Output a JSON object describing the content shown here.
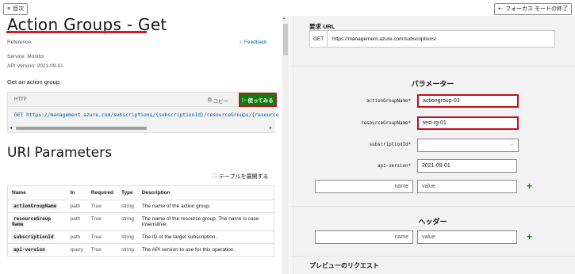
{
  "top": {
    "toc_label": "目次",
    "focus_exit_label": "フォーカス モードの終了"
  },
  "doc": {
    "title": "Action Groups - Get",
    "reference": "Reference",
    "feedback": "Feedback",
    "service": "Service:  Monitor",
    "api_version": "API Version:  2021-09-01",
    "description": "Get an action group.",
    "code": {
      "lang": "HTTP",
      "copy": "コピー",
      "try": "使ってみる",
      "line": "GET https://management.azure.com/subscriptions/{subscriptionId}/resourceGroups/{resource"
    },
    "uri_params_heading": "URI Parameters",
    "expand_table": "テーブルを展開する",
    "table": {
      "headers": [
        "Name",
        "In",
        "Required",
        "Type",
        "Description"
      ],
      "rows": [
        {
          "name": "actionGroupName",
          "in": "path",
          "required": "True",
          "type": "string",
          "desc": "The name of the action group."
        },
        {
          "name": "resourceGroup Name",
          "in": "path",
          "required": "True",
          "type": "string",
          "desc": "The name of the resource group. The name is case insensitive."
        },
        {
          "name": "subscriptionId",
          "in": "path",
          "required": "True",
          "type": "string",
          "desc": "The ID of the target subscription."
        },
        {
          "name": "api-version",
          "in": "query",
          "required": "True",
          "type": "string",
          "desc": "The API version to use for this operation."
        }
      ]
    }
  },
  "tryit": {
    "request_url_label": "要求 URL",
    "method": "GET",
    "url": "https://management.azure.com/subscriptions/",
    "params_title": "パラメーター",
    "params": {
      "action_group_label": "actionGroupName*",
      "action_group_value": "actiongroup-03",
      "resource_group_label": "resourceGroupName*",
      "resource_group_value": "test-rg-01",
      "subscription_label": "subscriptionId*",
      "subscription_value": "",
      "api_version_label": "api-version*",
      "api_version_value": "2021-09-01",
      "name_placeholder": "name",
      "value_placeholder": "value"
    },
    "headers_title": "ヘッダー",
    "header_name_placeholder": "name",
    "header_value_placeholder": "value",
    "preview_title": "プレビューのリクエスト"
  },
  "colors": {
    "accent_red": "#c50f1f",
    "try_green": "#107c10",
    "link_blue": "#0065b3"
  }
}
